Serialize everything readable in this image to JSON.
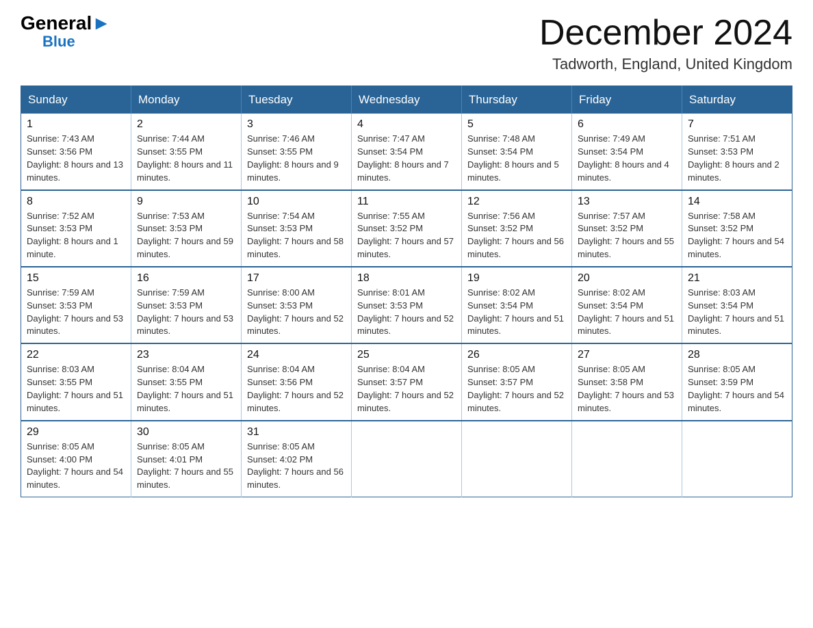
{
  "header": {
    "logo_general": "General",
    "logo_blue": "Blue",
    "month_title": "December 2024",
    "location": "Tadworth, England, United Kingdom"
  },
  "days_of_week": [
    "Sunday",
    "Monday",
    "Tuesday",
    "Wednesday",
    "Thursday",
    "Friday",
    "Saturday"
  ],
  "weeks": [
    [
      {
        "day": "1",
        "sunrise": "7:43 AM",
        "sunset": "3:56 PM",
        "daylight": "8 hours and 13 minutes."
      },
      {
        "day": "2",
        "sunrise": "7:44 AM",
        "sunset": "3:55 PM",
        "daylight": "8 hours and 11 minutes."
      },
      {
        "day": "3",
        "sunrise": "7:46 AM",
        "sunset": "3:55 PM",
        "daylight": "8 hours and 9 minutes."
      },
      {
        "day": "4",
        "sunrise": "7:47 AM",
        "sunset": "3:54 PM",
        "daylight": "8 hours and 7 minutes."
      },
      {
        "day": "5",
        "sunrise": "7:48 AM",
        "sunset": "3:54 PM",
        "daylight": "8 hours and 5 minutes."
      },
      {
        "day": "6",
        "sunrise": "7:49 AM",
        "sunset": "3:54 PM",
        "daylight": "8 hours and 4 minutes."
      },
      {
        "day": "7",
        "sunrise": "7:51 AM",
        "sunset": "3:53 PM",
        "daylight": "8 hours and 2 minutes."
      }
    ],
    [
      {
        "day": "8",
        "sunrise": "7:52 AM",
        "sunset": "3:53 PM",
        "daylight": "8 hours and 1 minute."
      },
      {
        "day": "9",
        "sunrise": "7:53 AM",
        "sunset": "3:53 PM",
        "daylight": "7 hours and 59 minutes."
      },
      {
        "day": "10",
        "sunrise": "7:54 AM",
        "sunset": "3:53 PM",
        "daylight": "7 hours and 58 minutes."
      },
      {
        "day": "11",
        "sunrise": "7:55 AM",
        "sunset": "3:52 PM",
        "daylight": "7 hours and 57 minutes."
      },
      {
        "day": "12",
        "sunrise": "7:56 AM",
        "sunset": "3:52 PM",
        "daylight": "7 hours and 56 minutes."
      },
      {
        "day": "13",
        "sunrise": "7:57 AM",
        "sunset": "3:52 PM",
        "daylight": "7 hours and 55 minutes."
      },
      {
        "day": "14",
        "sunrise": "7:58 AM",
        "sunset": "3:52 PM",
        "daylight": "7 hours and 54 minutes."
      }
    ],
    [
      {
        "day": "15",
        "sunrise": "7:59 AM",
        "sunset": "3:53 PM",
        "daylight": "7 hours and 53 minutes."
      },
      {
        "day": "16",
        "sunrise": "7:59 AM",
        "sunset": "3:53 PM",
        "daylight": "7 hours and 53 minutes."
      },
      {
        "day": "17",
        "sunrise": "8:00 AM",
        "sunset": "3:53 PM",
        "daylight": "7 hours and 52 minutes."
      },
      {
        "day": "18",
        "sunrise": "8:01 AM",
        "sunset": "3:53 PM",
        "daylight": "7 hours and 52 minutes."
      },
      {
        "day": "19",
        "sunrise": "8:02 AM",
        "sunset": "3:54 PM",
        "daylight": "7 hours and 51 minutes."
      },
      {
        "day": "20",
        "sunrise": "8:02 AM",
        "sunset": "3:54 PM",
        "daylight": "7 hours and 51 minutes."
      },
      {
        "day": "21",
        "sunrise": "8:03 AM",
        "sunset": "3:54 PM",
        "daylight": "7 hours and 51 minutes."
      }
    ],
    [
      {
        "day": "22",
        "sunrise": "8:03 AM",
        "sunset": "3:55 PM",
        "daylight": "7 hours and 51 minutes."
      },
      {
        "day": "23",
        "sunrise": "8:04 AM",
        "sunset": "3:55 PM",
        "daylight": "7 hours and 51 minutes."
      },
      {
        "day": "24",
        "sunrise": "8:04 AM",
        "sunset": "3:56 PM",
        "daylight": "7 hours and 52 minutes."
      },
      {
        "day": "25",
        "sunrise": "8:04 AM",
        "sunset": "3:57 PM",
        "daylight": "7 hours and 52 minutes."
      },
      {
        "day": "26",
        "sunrise": "8:05 AM",
        "sunset": "3:57 PM",
        "daylight": "7 hours and 52 minutes."
      },
      {
        "day": "27",
        "sunrise": "8:05 AM",
        "sunset": "3:58 PM",
        "daylight": "7 hours and 53 minutes."
      },
      {
        "day": "28",
        "sunrise": "8:05 AM",
        "sunset": "3:59 PM",
        "daylight": "7 hours and 54 minutes."
      }
    ],
    [
      {
        "day": "29",
        "sunrise": "8:05 AM",
        "sunset": "4:00 PM",
        "daylight": "7 hours and 54 minutes."
      },
      {
        "day": "30",
        "sunrise": "8:05 AM",
        "sunset": "4:01 PM",
        "daylight": "7 hours and 55 minutes."
      },
      {
        "day": "31",
        "sunrise": "8:05 AM",
        "sunset": "4:02 PM",
        "daylight": "7 hours and 56 minutes."
      },
      null,
      null,
      null,
      null
    ]
  ]
}
